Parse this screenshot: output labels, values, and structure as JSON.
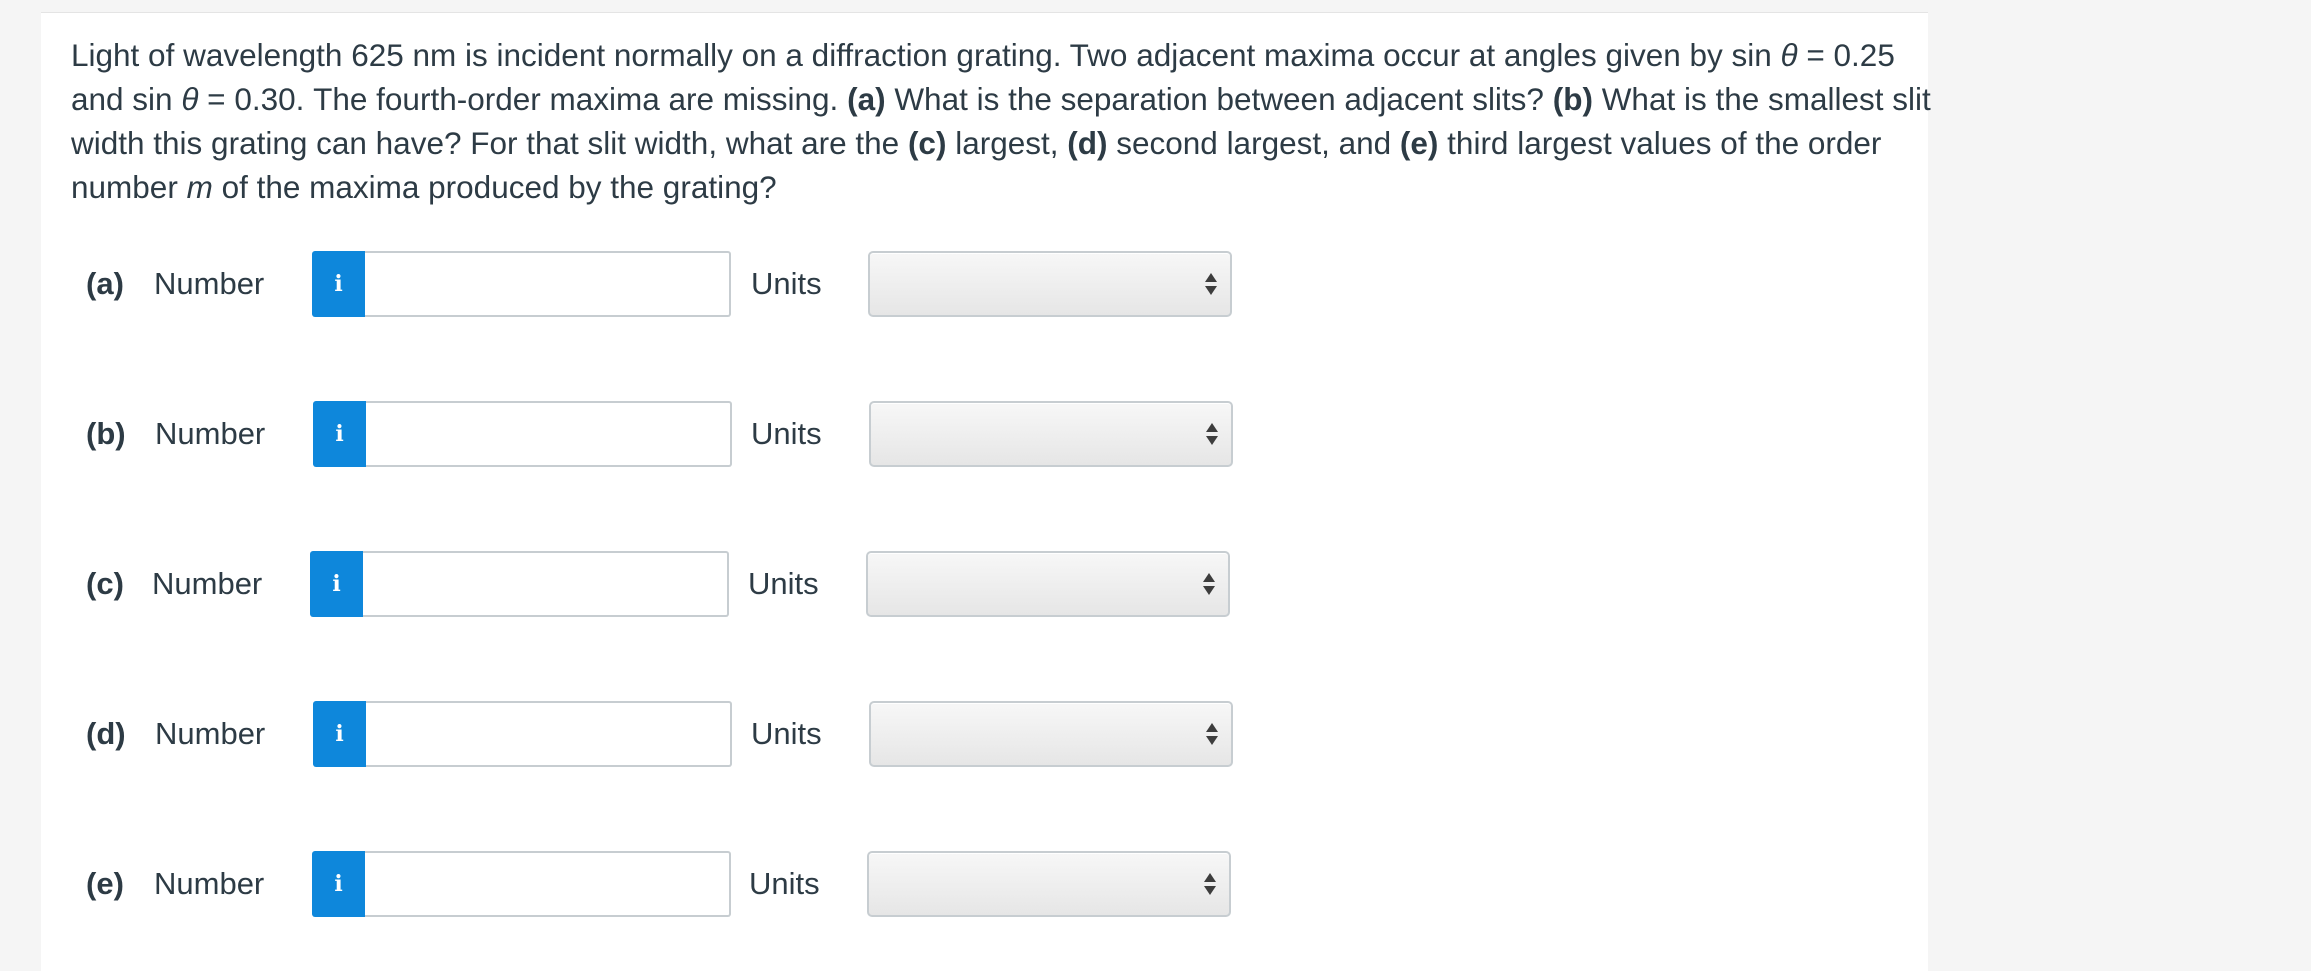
{
  "question": {
    "seg1": "Light of wavelength 625 nm is incident normally on a diffraction grating. Two adjacent maxima occur at angles given by sin ",
    "theta1": "θ",
    "seg2": " = 0.25 and sin ",
    "theta2": "θ",
    "seg3": " = 0.30. The fourth-order maxima are missing. ",
    "a_tag": "(a)",
    "seg4": " What is the separation between adjacent slits? ",
    "b_tag": "(b)",
    "seg5": " What is the smallest slit width this grating can have? For that slit width, what are the ",
    "c_tag": "(c)",
    "seg6": " largest, ",
    "d_tag": "(d)",
    "seg7": " second largest, and ",
    "e_tag": "(e)",
    "seg8": " third largest values of the order number ",
    "m_var": "m",
    "seg9": " of the maxima produced by the grating?"
  },
  "parts": [
    {
      "label": "(a)",
      "number_label": "Number",
      "info_icon": "i",
      "value": "",
      "units_label": "Units",
      "units_selected": ""
    },
    {
      "label": "(b)",
      "number_label": "Number",
      "info_icon": "i",
      "value": "",
      "units_label": "Units",
      "units_selected": ""
    },
    {
      "label": "(c)",
      "number_label": "Number",
      "info_icon": "i",
      "value": "",
      "units_label": "Units",
      "units_selected": ""
    },
    {
      "label": "(d)",
      "number_label": "Number",
      "info_icon": "i",
      "value": "",
      "units_label": "Units",
      "units_selected": ""
    },
    {
      "label": "(e)",
      "number_label": "Number",
      "info_icon": "i",
      "value": "",
      "units_label": "Units",
      "units_selected": ""
    }
  ],
  "colors": {
    "info_button": "#0e87db",
    "text": "#2d3b45",
    "background": "#f5f5f5",
    "card": "#ffffff"
  }
}
